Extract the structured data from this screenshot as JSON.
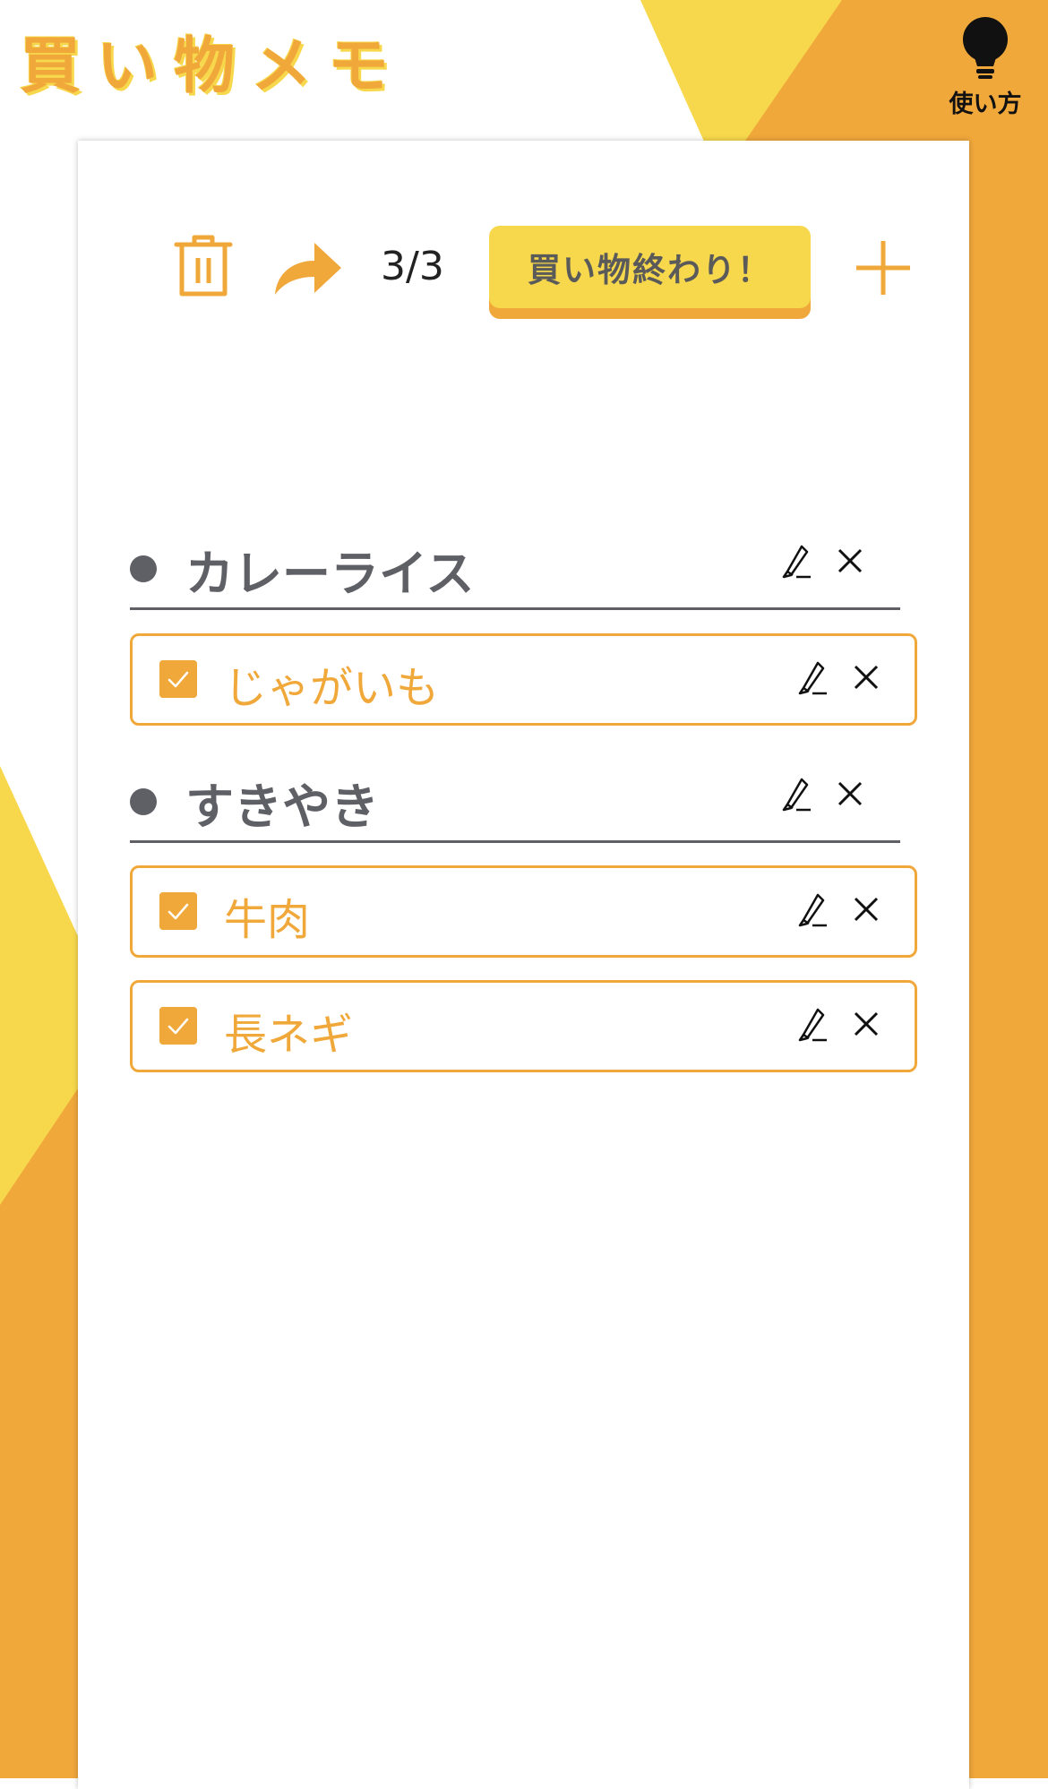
{
  "app": {
    "title": "買い物メモ",
    "help_label": "使い方"
  },
  "toolbar": {
    "delete_icon": "trash-icon",
    "share_icon": "share-arrow-icon",
    "counter": "3/3",
    "finish_label": "買い物終わり！",
    "add_icon": "plus-icon"
  },
  "lists": [
    {
      "name": "カレーライス",
      "items": [
        {
          "name": "じゃがいも",
          "checked": true
        }
      ]
    },
    {
      "name": "すきやき",
      "items": [
        {
          "name": "牛肉",
          "checked": true
        },
        {
          "name": "長ネギ",
          "checked": true
        }
      ]
    }
  ],
  "colors": {
    "accent_orange": "#F1A83B",
    "accent_yellow": "#F7D84C",
    "heading_gray": "#5F5F66"
  }
}
